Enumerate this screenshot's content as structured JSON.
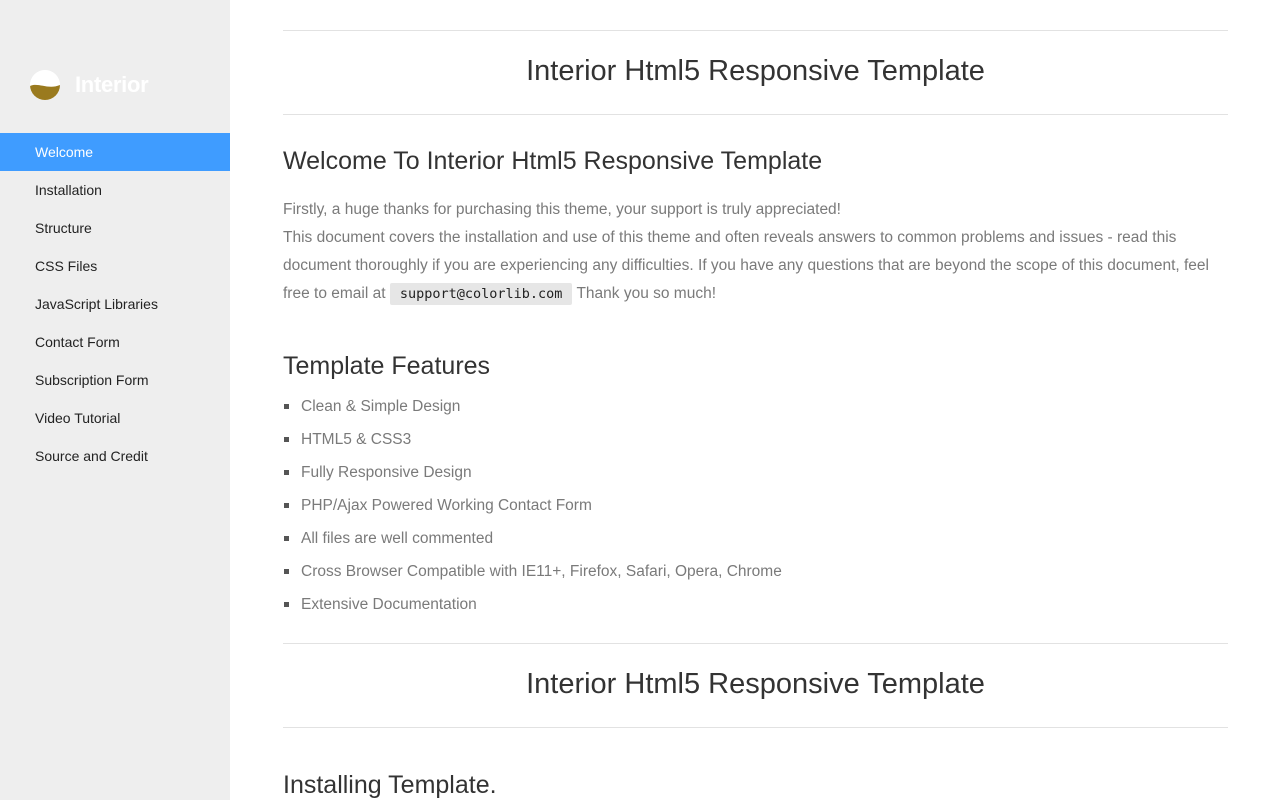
{
  "sidebar": {
    "logo_text": "Interior",
    "logo_icon": "interior-logo-icon",
    "items": [
      {
        "label": "Welcome",
        "active": true
      },
      {
        "label": "Installation",
        "active": false
      },
      {
        "label": "Structure",
        "active": false
      },
      {
        "label": "CSS Files",
        "active": false
      },
      {
        "label": "JavaScript Libraries",
        "active": false
      },
      {
        "label": "Contact Form",
        "active": false
      },
      {
        "label": "Subscription Form",
        "active": false
      },
      {
        "label": "Video Tutorial",
        "active": false
      },
      {
        "label": "Source and Credit",
        "active": false
      }
    ]
  },
  "main": {
    "banner_title": "Interior Html5 Responsive Template",
    "welcome_title": "Welcome To Interior Html5 Responsive Template",
    "intro_line1": "Firstly, a huge thanks for purchasing this theme, your support is truly appreciated!",
    "intro_line2": "This document covers the installation and use of this theme and often reveals answers to common problems and issues - read this document thoroughly if you are experiencing any difficulties. If you have any questions that are beyond the scope of this document, feel free to email at",
    "email": "support@colorlib.com",
    "intro_tail": "Thank you so much!",
    "features_title": "Template Features",
    "features": [
      "Clean & Simple Design",
      "HTML5 & CSS3",
      "Fully Responsive Design",
      "PHP/Ajax Powered Working Contact Form",
      "All files are well commented",
      "Cross Browser Compatible with IE11+, Firefox, Safari, Opera, Chrome",
      "Extensive Documentation"
    ],
    "banner_title_2": "Interior Html5 Responsive Template",
    "install_title": "Installing Template."
  },
  "colors": {
    "sidebar_bg": "#eeeeee",
    "active_item": "#3f9cff",
    "logo_gold": "#9a7a1e"
  }
}
